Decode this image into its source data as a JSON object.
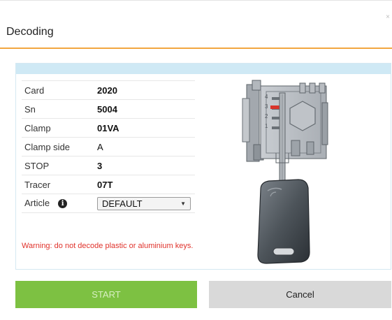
{
  "dialog": {
    "title": "Decoding",
    "close_glyph": "×"
  },
  "info": {
    "rows": [
      {
        "label": "Card",
        "value": "2020"
      },
      {
        "label": "Sn",
        "value": "5004"
      },
      {
        "label": "Clamp",
        "value": "01VA"
      },
      {
        "label": "Clamp side",
        "value": "A"
      },
      {
        "label": "STOP",
        "value": "3"
      },
      {
        "label": "Tracer",
        "value": "07T"
      }
    ],
    "article": {
      "label": "Article",
      "icon": "info-icon",
      "selected": "DEFAULT"
    }
  },
  "warning": "Warning: do not decode plastic or aluminium keys.",
  "figure": {
    "scale_marks": [
      "4",
      "3",
      "2",
      "1"
    ]
  },
  "buttons": {
    "start": "START",
    "cancel": "Cancel"
  },
  "colors": {
    "accent_rule": "#f2a640",
    "panel_band": "#cfe9f5",
    "start_button": "#7dc142",
    "cancel_button": "#d9d9d9",
    "warning_text": "#e0322b",
    "stop_marker": "#d9342b"
  }
}
